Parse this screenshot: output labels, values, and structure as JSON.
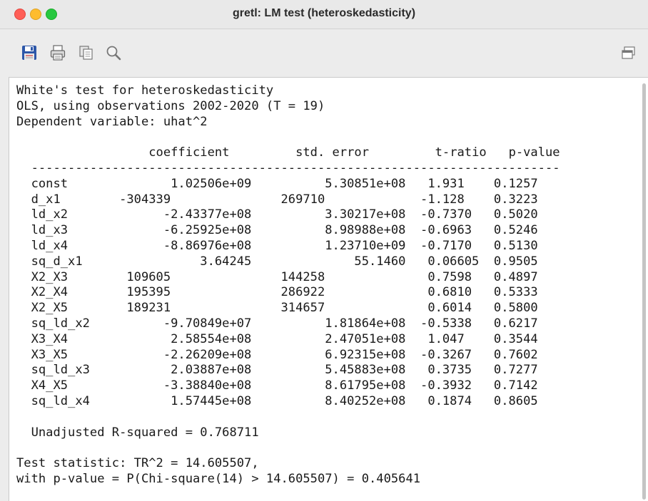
{
  "window": {
    "title": "gretl: LM test (heteroskedasticity)"
  },
  "toolbar": {
    "icons": [
      "save-icon",
      "print-icon",
      "copy-icon",
      "search-icon",
      "window-icon"
    ]
  },
  "output": {
    "header": [
      "White's test for heteroskedasticity",
      "OLS, using observations 2002-2020 (T = 19)",
      "Dependent variable: uhat^2"
    ],
    "columns": [
      "coefficient",
      "std. error",
      "t-ratio",
      "p-value"
    ],
    "rows": [
      [
        "const",
        "1.02506e+09",
        "5.30851e+08",
        "1.931",
        "0.1257"
      ],
      [
        "d_x1",
        "-304339",
        "269710",
        "-1.128",
        "0.3223"
      ],
      [
        "ld_x2",
        "-2.43377e+08",
        "3.30217e+08",
        "-0.7370",
        "0.5020"
      ],
      [
        "ld_x3",
        "-6.25925e+08",
        "8.98988e+08",
        "-0.6963",
        "0.5246"
      ],
      [
        "ld_x4",
        "-8.86976e+08",
        "1.23710e+09",
        "-0.7170",
        "0.5130"
      ],
      [
        "sq_d_x1",
        "3.64245",
        "55.1460",
        "0.06605",
        "0.9505"
      ],
      [
        "X2_X3",
        "109605",
        "144258",
        "0.7598",
        "0.4897"
      ],
      [
        "X2_X4",
        "195395",
        "286922",
        "0.6810",
        "0.5333"
      ],
      [
        "X2_X5",
        "189231",
        "314657",
        "0.6014",
        "0.5800"
      ],
      [
        "sq_ld_x2",
        "-9.70849e+07",
        "1.81864e+08",
        "-0.5338",
        "0.6217"
      ],
      [
        "X3_X4",
        "2.58554e+08",
        "2.47051e+08",
        "1.047",
        "0.3544"
      ],
      [
        "X3_X5",
        "-2.26209e+08",
        "6.92315e+08",
        "-0.3267",
        "0.7602"
      ],
      [
        "sq_ld_x3",
        "2.03887e+08",
        "5.45883e+08",
        "0.3735",
        "0.7277"
      ],
      [
        "X4_X5",
        "-3.38840e+08",
        "8.61795e+08",
        "-0.3932",
        "0.7142"
      ],
      [
        "sq_ld_x4",
        "1.57445e+08",
        "8.40252e+08",
        "0.1874",
        "0.8605"
      ]
    ],
    "r_squared": "  Unadjusted R-squared = 0.768711",
    "test_statistic": "Test statistic: TR^2 = 14.605507,",
    "p_value_line": "with p-value = P(Chi-square(14) > 14.605507) = 0.405641"
  }
}
